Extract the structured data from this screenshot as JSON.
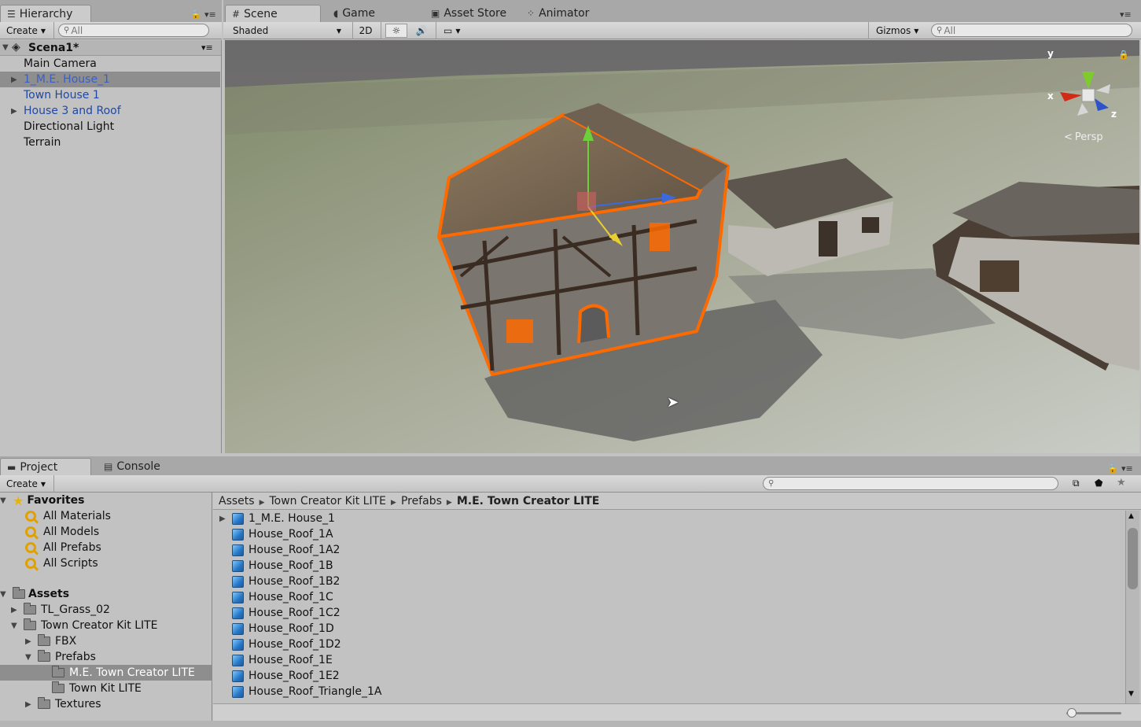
{
  "hierarchy": {
    "tab_label": "Hierarchy",
    "create_label": "Create",
    "search_placeholder": "All",
    "scene_name": "Scena1*",
    "items": [
      {
        "label": "Main Camera",
        "prefab": false,
        "expandable": false,
        "selected": false
      },
      {
        "label": "1_M.E. House_1",
        "prefab": true,
        "expandable": true,
        "selected": true
      },
      {
        "label": "Town House 1",
        "prefab": true,
        "expandable": false,
        "selected": false
      },
      {
        "label": "House 3 and Roof",
        "prefab": true,
        "expandable": true,
        "selected": false
      },
      {
        "label": "Directional Light",
        "prefab": false,
        "expandable": false,
        "selected": false
      },
      {
        "label": "Terrain",
        "prefab": false,
        "expandable": false,
        "selected": false
      }
    ]
  },
  "scene_tabs": [
    {
      "label": "Scene",
      "icon": "grid-icon"
    },
    {
      "label": "Game",
      "icon": "pacman-icon"
    },
    {
      "label": "Asset Store",
      "icon": "bag-icon"
    },
    {
      "label": "Animator",
      "icon": "animator-icon"
    }
  ],
  "scene_toolbar": {
    "shading_mode": "Shaded",
    "mode_2d": "2D",
    "gizmos_label": "Gizmos",
    "search_placeholder": "All"
  },
  "scene_view": {
    "projection_label": "Persp",
    "axis_x": "x",
    "axis_y": "y",
    "axis_z": "z"
  },
  "project": {
    "tabs": [
      "Project",
      "Console"
    ],
    "create_label": "Create",
    "favorites_label": "Favorites",
    "favorites": [
      "All Materials",
      "All Models",
      "All Prefabs",
      "All Scripts"
    ],
    "assets_label": "Assets",
    "tree": [
      {
        "label": "TL_Grass_02",
        "depth": 1,
        "arrow": "right"
      },
      {
        "label": "Town Creator Kit LITE",
        "depth": 1,
        "arrow": "down"
      },
      {
        "label": "FBX",
        "depth": 2,
        "arrow": "right"
      },
      {
        "label": "Prefabs",
        "depth": 2,
        "arrow": "down"
      },
      {
        "label": "M.E. Town Creator LITE",
        "depth": 3,
        "arrow": "",
        "selected": true
      },
      {
        "label": "Town Kit LITE",
        "depth": 3,
        "arrow": ""
      },
      {
        "label": "Textures",
        "depth": 2,
        "arrow": "right"
      }
    ],
    "breadcrumb": [
      "Assets",
      "Town Creator Kit LITE",
      "Prefabs",
      "M.E. Town Creator LITE"
    ],
    "assets": [
      "1_M.E. House_1",
      "House_Roof_1A",
      "House_Roof_1A2",
      "House_Roof_1B",
      "House_Roof_1B2",
      "House_Roof_1C",
      "House_Roof_1C2",
      "House_Roof_1D",
      "House_Roof_1D2",
      "House_Roof_1E",
      "House_Roof_1E2",
      "House_Roof_Triangle_1A"
    ]
  },
  "colors": {
    "selection_outline": "#ff6a00",
    "prefab_text": "#1f49a6",
    "panel_bg": "#c2c2c2",
    "selected_row": "#8e8e8e"
  }
}
